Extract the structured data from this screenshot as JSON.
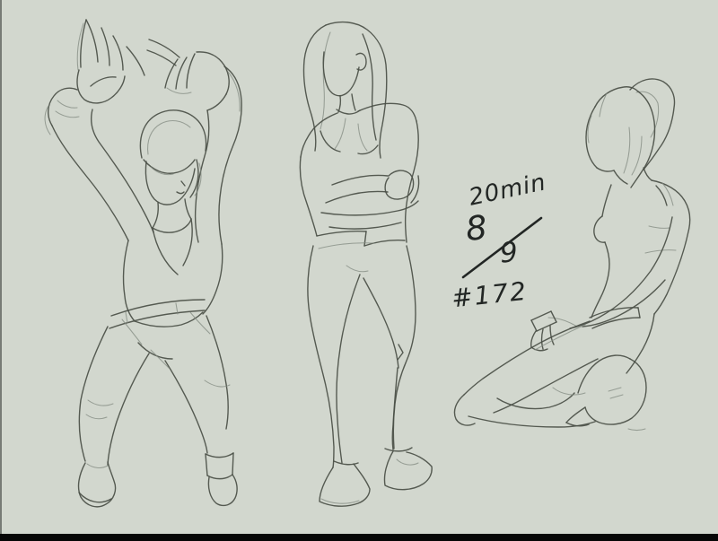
{
  "canvas": {
    "background_color": "#d2d7ce",
    "sketch_stroke_color": "#4a4f47",
    "ink_color": "#222624",
    "bottom_bar_color": "#060606"
  },
  "annotations": {
    "duration": "20min",
    "pose_numerator": "8",
    "pose_denominator": "9",
    "session_number": "#172"
  },
  "figures": [
    {
      "name": "figure-arms-raised",
      "description": "gesture sketch: figure with both arms raised overhead, hands open"
    },
    {
      "name": "figure-arms-crossed",
      "description": "gesture sketch: standing long-haired figure with arms crossed"
    },
    {
      "name": "figure-kneeling",
      "description": "gesture sketch: kneeling figure with ponytail, hands on knee"
    }
  ]
}
